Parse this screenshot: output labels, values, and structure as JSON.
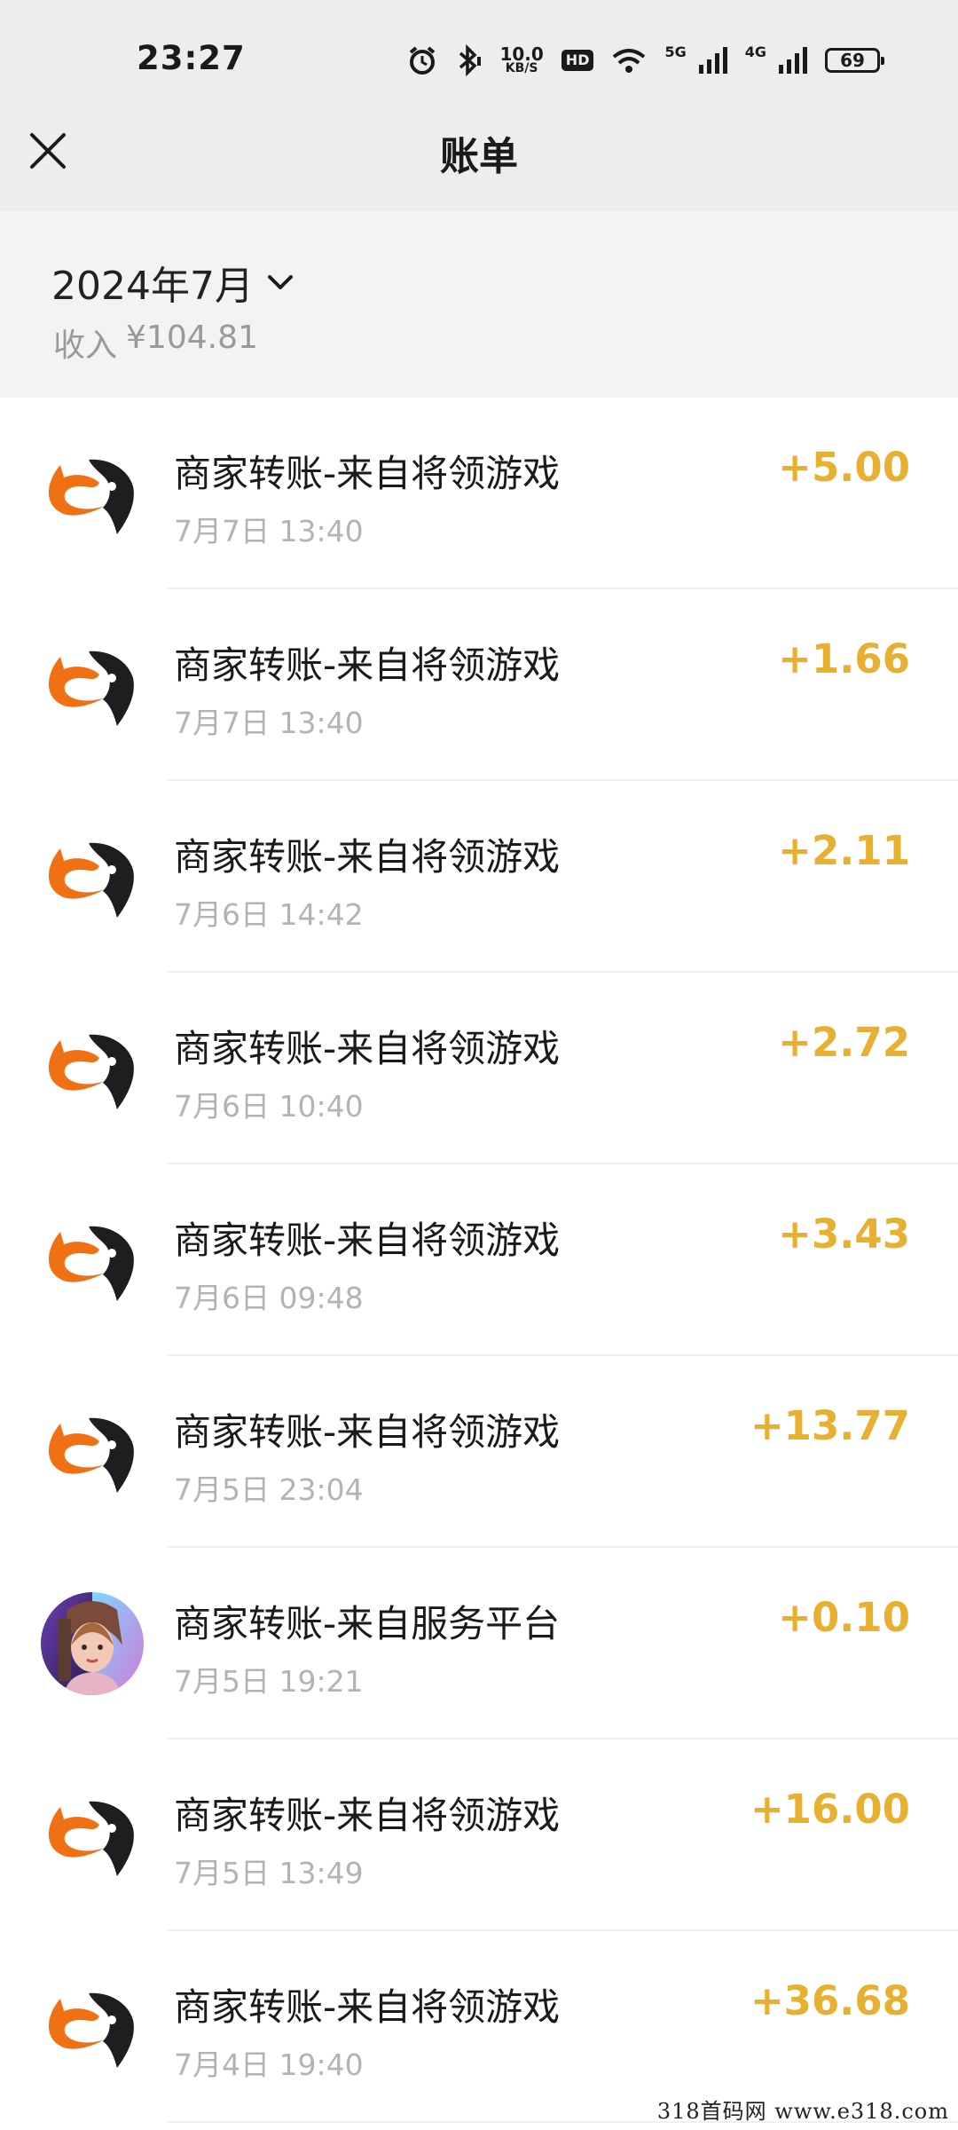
{
  "status_bar": {
    "time": "23:27",
    "net_speed": "10.0",
    "net_unit": "KB/S",
    "hd": "HD",
    "signal1": "5G",
    "signal2": "4G",
    "battery": "69",
    "icons": [
      "alarm-icon",
      "bluetooth-icon",
      "wifi-icon",
      "signal-icon"
    ]
  },
  "nav": {
    "title": "账单",
    "close_icon": "close-icon"
  },
  "summary": {
    "month": "2024年7月",
    "income_label": "收入",
    "income_value": "¥104.81"
  },
  "colors": {
    "amount": "#e8b031",
    "brand_orange": "#f07014",
    "background_header": "#ededed"
  },
  "transactions": [
    {
      "title": "商家转账-来自将领游戏",
      "time": "7月7日 13:40",
      "amount": "+5.00",
      "avatar": "game-logo"
    },
    {
      "title": "商家转账-来自将领游戏",
      "time": "7月7日 13:40",
      "amount": "+1.66",
      "avatar": "game-logo"
    },
    {
      "title": "商家转账-来自将领游戏",
      "time": "7月6日 14:42",
      "amount": "+2.11",
      "avatar": "game-logo"
    },
    {
      "title": "商家转账-来自将领游戏",
      "time": "7月6日 10:40",
      "amount": "+2.72",
      "avatar": "game-logo"
    },
    {
      "title": "商家转账-来自将领游戏",
      "time": "7月6日 09:48",
      "amount": "+3.43",
      "avatar": "game-logo"
    },
    {
      "title": "商家转账-来自将领游戏",
      "time": "7月5日 23:04",
      "amount": "+13.77",
      "avatar": "game-logo"
    },
    {
      "title": "商家转账-来自服务平台",
      "time": "7月5日 19:21",
      "amount": "+0.10",
      "avatar": "service-platform-avatar"
    },
    {
      "title": "商家转账-来自将领游戏",
      "time": "7月5日 13:49",
      "amount": "+16.00",
      "avatar": "game-logo"
    },
    {
      "title": "商家转账-来自将领游戏",
      "time": "7月4日 19:40",
      "amount": "+36.68",
      "avatar": "game-logo"
    }
  ],
  "watermark": "318首码网  www.e318.com"
}
